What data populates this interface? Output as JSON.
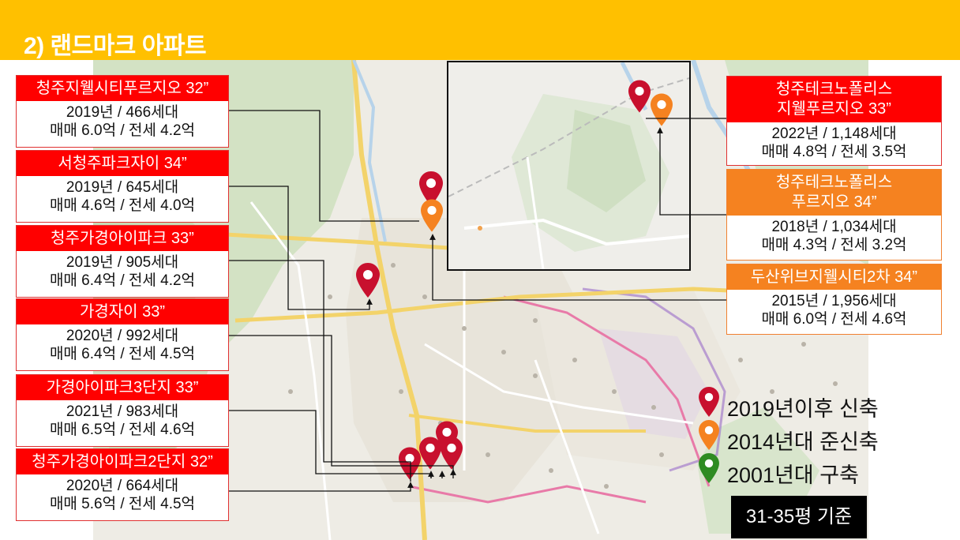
{
  "header": {
    "title": "2) 랜드마크 아파트"
  },
  "left_cards": [
    {
      "name": "청주지웰시티푸르지오 32”",
      "line1": "2019년 / 466세대",
      "line2": "매매 6.0억 / 전세 4.2억"
    },
    {
      "name": "서청주파크자이 34”",
      "line1": "2019년 / 645세대",
      "line2": "매매 4.6억 / 전세 4.0억"
    },
    {
      "name": "청주가경아이파크 33”",
      "line1": "2019년 / 905세대",
      "line2": "매매 6.4억 / 전세 4.2억"
    },
    {
      "name": "가경자이 33”",
      "line1": "2020년 / 992세대",
      "line2": "매매 6.4억 / 전세 4.5억"
    },
    {
      "name": "가경아이파크3단지 33”",
      "line1": "2021년 / 983세대",
      "line2": "매매 6.5억 / 전세 4.6억"
    },
    {
      "name": "청주가경아이파크2단지 32”",
      "line1": "2020년 / 664세대",
      "line2": "매매 5.6억 / 전세 4.5억"
    }
  ],
  "right_cards": [
    {
      "name_l1": "청주테크노폴리스",
      "name_l2": "지웰푸르지오 33”",
      "line1": "2022년 / 1,148세대",
      "line2": "매매 4.8억 / 전세 3.5억"
    },
    {
      "name_l1": "청주테크노폴리스",
      "name_l2": "푸르지오 34”",
      "line1": "2018년 / 1,034세대",
      "line2": "매매 4.3억 / 전세 3.2억"
    },
    {
      "name": "두산위브지웰시티2차 34”",
      "line1": "2015년 / 1,956세대",
      "line2": "매매 6.0억 / 전세 4.6억"
    }
  ],
  "legend": [
    {
      "label": "2019년이후 신축",
      "color": "#C8102E",
      "icon": "map-pin-icon"
    },
    {
      "label": "2014년대 준신축",
      "color": "#F58220",
      "icon": "map-pin-icon"
    },
    {
      "label": "2001년대 구축",
      "color": "#2E8B22",
      "icon": "map-pin-icon"
    }
  ],
  "badge": {
    "label": "31-35평 기준"
  },
  "colors": {
    "header": "#FFC000",
    "red": "#FF0000",
    "orange": "#F58220",
    "pin_red": "#C8102E"
  }
}
